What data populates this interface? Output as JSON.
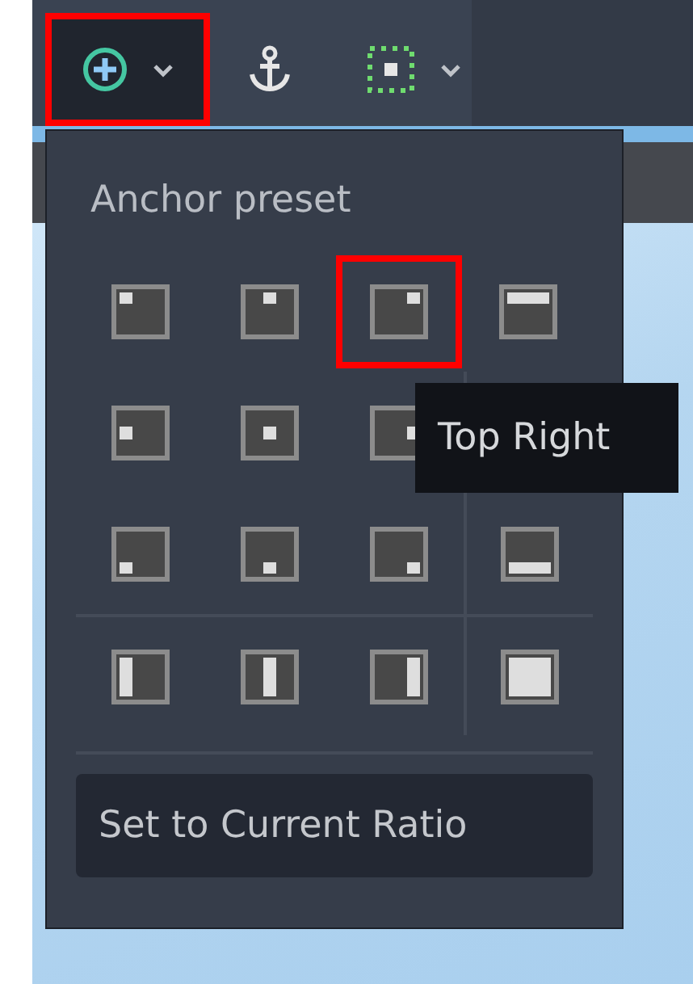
{
  "toolbar": {
    "items": [
      {
        "kind": "anchor_preset_menu",
        "pressed": true,
        "highlighted": true
      },
      {
        "kind": "anchor",
        "pressed": false,
        "highlighted": false
      },
      {
        "kind": "container_sizing_menu",
        "pressed": false,
        "highlighted": false
      }
    ]
  },
  "popup": {
    "title": "Anchor preset",
    "rows": [
      [
        {
          "kind": "top_left",
          "highlighted": false
        },
        {
          "kind": "center_top",
          "highlighted": false
        },
        {
          "kind": "top_right",
          "highlighted": true
        },
        {
          "kind": "top_wide",
          "highlighted": false
        }
      ],
      [
        {
          "kind": "center_left",
          "highlighted": false
        },
        {
          "kind": "center",
          "highlighted": false
        },
        {
          "kind": "center_right",
          "highlighted": false
        }
      ],
      [
        {
          "kind": "bottom_left",
          "highlighted": false
        },
        {
          "kind": "center_bottom",
          "highlighted": false
        },
        {
          "kind": "bottom_right",
          "highlighted": false
        },
        {
          "kind": "bottom_wide",
          "highlighted": false
        }
      ],
      [
        {
          "kind": "left_wide",
          "highlighted": false
        },
        {
          "kind": "vcenter_wide",
          "highlighted": false
        },
        {
          "kind": "right_wide",
          "highlighted": false
        },
        {
          "kind": "full_rect",
          "highlighted": false
        }
      ]
    ],
    "button": "Set to Current Ratio"
  },
  "tooltip": "Top Right"
}
